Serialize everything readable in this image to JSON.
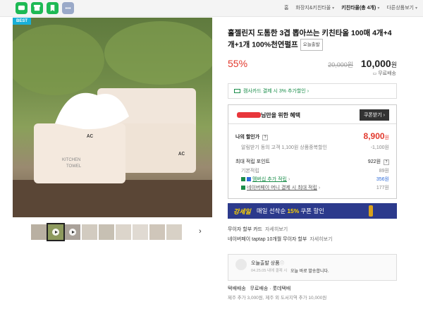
{
  "topbar": {
    "icon_colors": [
      "#1db954",
      "#1db954",
      "#1db954",
      "#9aa9c8"
    ],
    "breadcrumb": {
      "home": "홈",
      "cat1": "화장지&키친타올",
      "cat2": "키친타올(총 4개)",
      "other": "다른상품보기"
    }
  },
  "product": {
    "best_label": "BEST",
    "title": "홀젤린지 도톰한 3겹 뽑아쓰는 키친타올 100매 4개+4개+1개 100%천연펄프",
    "badge": "오늘출발",
    "discount_rate": "55%",
    "original_price": "20,000원",
    "price_value": "10,000",
    "price_unit": "원",
    "shipping": "무료배송"
  },
  "card_promo": "캠사카드 결제 시 3% 추가할인",
  "benefit": {
    "title_suffix": "님만을 위한 혜택",
    "coupon_button": "쿠폰받기",
    "my_discount_label": "나의 할인가",
    "my_discount_value": "8,900",
    "my_discount_unit": "원",
    "sub_discount_label": "알림받기 동의 고객 1,100원 상품중복할인",
    "sub_discount_value": "-1,100원",
    "points_label": "최대 적립 포인트",
    "points_value": "922원",
    "points_rows": [
      {
        "label": "기본적립",
        "value": "89원"
      },
      {
        "label": "멤버십 추가 적립",
        "value": "356원"
      },
      {
        "label": "네이버페이 머니 결제 시 최대 적립",
        "value": "177원"
      }
    ]
  },
  "banner": {
    "logo": "강세일",
    "text_before": "매일 선착순",
    "highlight": "15%",
    "text_after": "쿠폰 할인"
  },
  "payments": [
    {
      "label": "무이자 할부 카드",
      "more": "자세히보기"
    },
    {
      "label": "네이버페이 taptap 10개월 무이자 할부",
      "more": "자세히보기"
    }
  ],
  "delivery": {
    "title": "오늘출발 상품",
    "date": "04.25.05 내에 결제 시",
    "note": "오늘 바로 발송합니다."
  },
  "ship_info": {
    "line": "택배배송   무료배송 · 롯데택배",
    "extra": "제주 추가 3,000원, 제주 외 도서지역 추가 10,000원"
  }
}
